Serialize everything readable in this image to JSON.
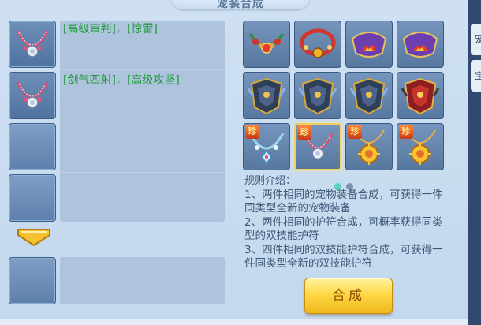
{
  "window": {
    "title": "宠装合成"
  },
  "left_list": {
    "items": [
      {
        "name1": "[高级审判]",
        "name2": "[惊雷]",
        "separator": "，"
      },
      {
        "name1": "[剑气四射]",
        "name2": "[高级攻坚]",
        "separator": "，"
      }
    ]
  },
  "rules": {
    "title": "规则介绍：",
    "lines": [
      "1、两件相同的宠物装备合成，可获得一件同类型全新的宠物装备",
      "2、两件相同的护符合成，可概率获得同类型的双技能护符",
      "3、四件相同的双技能护符合成，可获得一件同类型全新的双技能护符"
    ]
  },
  "grid": {
    "rare_badge": "珍",
    "items": [
      {
        "icon": "ruby-collar-icon",
        "rare": false
      },
      {
        "icon": "red-ring-collar-icon",
        "rare": false
      },
      {
        "icon": "flame-crown-collar-icon",
        "rare": false
      },
      {
        "icon": "flame-crown-collar-icon",
        "rare": false
      },
      {
        "icon": "dragon-armor-icon",
        "rare": false
      },
      {
        "icon": "dragon-armor-icon",
        "rare": false
      },
      {
        "icon": "dragon-armor-icon",
        "rare": false
      },
      {
        "icon": "red-dragon-armor-icon",
        "rare": false
      },
      {
        "icon": "crystal-necklace-icon",
        "rare": true
      },
      {
        "icon": "pink-necklace-icon",
        "rare": true
      },
      {
        "icon": "sun-amulet-icon",
        "rare": true
      },
      {
        "icon": "sun-amulet-icon",
        "rare": true
      }
    ]
  },
  "pager": {
    "pages": 2,
    "current": 1
  },
  "actions": {
    "combine_label": "合成"
  },
  "side_tabs": {
    "a": "宠",
    "b": "宝"
  },
  "colors": {
    "green_text": "#1e9a36",
    "rule_text": "#3e5776",
    "button": "#ffd847"
  }
}
